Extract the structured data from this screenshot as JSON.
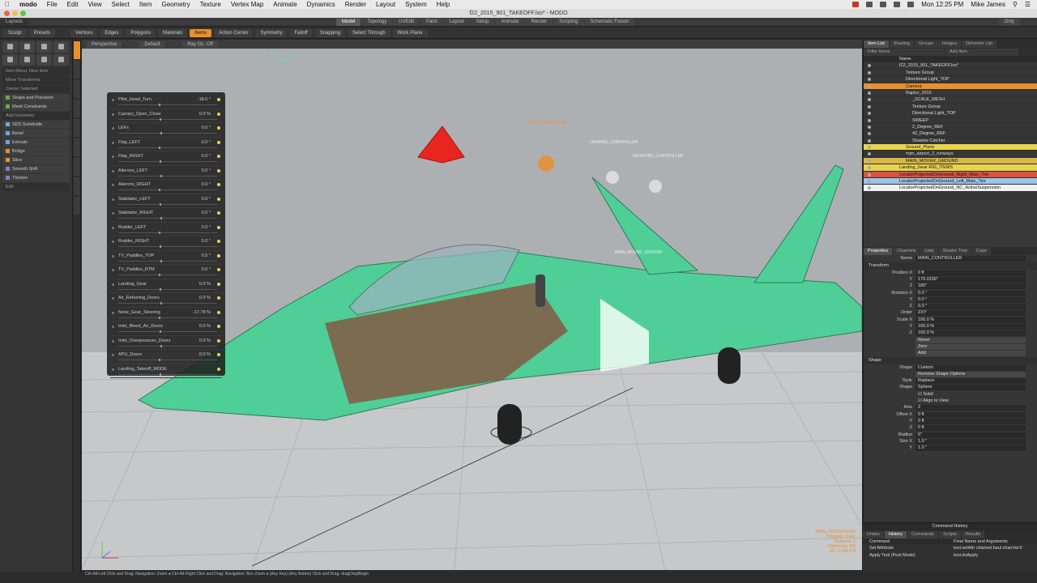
{
  "menubar": {
    "apple": "",
    "app_name": "modo",
    "items": [
      "File",
      "Edit",
      "View",
      "Select",
      "Item",
      "Geometry",
      "Texture",
      "Vertex Map",
      "Animate",
      "Dynamics",
      "Render",
      "Layout",
      "System",
      "Help"
    ],
    "clock": "Mon 12:25 PM",
    "user": "Mike James"
  },
  "window": {
    "title": "f22_2015_901_TAKEOFF.lxo* - MODO"
  },
  "layout_bar": {
    "layouts_label": "Layouts",
    "tabs": [
      "Model",
      "Topology",
      "UVEdit",
      "Paint",
      "Layout",
      "Setup",
      "Animate",
      "Render",
      "Scripting",
      "Schematic Fusion"
    ],
    "active_tab": "Model",
    "right_label": "Only"
  },
  "toolbar": {
    "items": [
      "Sculpt",
      "Presets",
      "Vertices",
      "Edges",
      "Polygons",
      "Materials",
      "Items",
      "Action Center",
      "Symmetry",
      "Falloff",
      "Snapping",
      "Select Through",
      "Work Plane"
    ],
    "active": "Items"
  },
  "left_panel": {
    "rows": [
      {
        "label": "Item Menu: New Item",
        "type": "hdr"
      },
      {
        "label": "Move Transforms",
        "type": "hdr"
      },
      {
        "label": "Center Selected",
        "type": "hdr"
      },
      {
        "label": "Shape and Precision",
        "type": "item"
      },
      {
        "label": "Mesh Constraints",
        "type": "item"
      },
      {
        "label": "Add Geometry",
        "type": "hdr"
      },
      {
        "label": "SDS Subdivide",
        "type": "item"
      },
      {
        "label": "Bevel",
        "type": "item"
      },
      {
        "label": "Extrude",
        "type": "item"
      },
      {
        "label": "Bridge",
        "type": "item"
      },
      {
        "label": "Slice",
        "type": "item"
      },
      {
        "label": "Smooth Shift",
        "type": "item"
      },
      {
        "label": "Thicken",
        "type": "item"
      },
      {
        "label": "Edit",
        "type": "hdr"
      }
    ]
  },
  "viewport": {
    "tabs": [
      "Perspective",
      "Default",
      "Ray GL: Off"
    ],
    "labels": [
      {
        "text": "MAIN_CONTROLLER",
        "color": "orange"
      },
      {
        "text": "LANDING_CONTROLLER",
        "color": "white"
      },
      {
        "text": "WEAPONS_CONTROLLER",
        "color": "white"
      },
      {
        "text": "MAIN_MOVER_GROUND",
        "color": "white"
      }
    ],
    "info_lines": [
      "MAIN_CONTROLLER",
      "Polygons : Face",
      "Channels: 1",
      "Deformers: ON",
      "GL: 1,288,478"
    ],
    "statusbar": "Ctrl-Alt-Left Click and Drag: Navigation: Zoom ● Ctrl-Alt-Right Click and Drag: Navigation: Box Zoom ● (Any Key)-(Any Button) Click and Drag: dragDropBegin"
  },
  "controller_panel": {
    "rows": [
      {
        "label": "Pilot_Head_Turn",
        "value": "-18.0 °"
      },
      {
        "label": "Canopy_Open_Close",
        "value": "0.0 %"
      },
      {
        "label": "LEFs",
        "value": "0.0 °"
      },
      {
        "label": "Flap_LEFT",
        "value": "0.0 °"
      },
      {
        "label": "Flap_RIGHT",
        "value": "0.0 °"
      },
      {
        "label": "Ailerons_LEFT",
        "value": "0.0 °"
      },
      {
        "label": "Ailerons_RIGHT",
        "value": "0.0 °"
      },
      {
        "label": "Stabilator_LEFT",
        "value": "0.0 °"
      },
      {
        "label": "Stabilator_RIGHT",
        "value": "0.0 °"
      },
      {
        "label": "Rudder_LEFT",
        "value": "0.0 °"
      },
      {
        "label": "Rudder_RIGHT",
        "value": "0.0 °"
      },
      {
        "label": "TV_Paddles_TOP",
        "value": "0.5 °"
      },
      {
        "label": "TV_Paddles_BTM",
        "value": "0.0 °"
      },
      {
        "label": "Landing_Gear",
        "value": "0.0 %"
      },
      {
        "label": "Air_Refueling_Doors",
        "value": "0.0 %"
      },
      {
        "label": "Nose_Gear_Steering",
        "value": "-17.78 %"
      },
      {
        "label": "Inlet_Bleed_Air_Doors",
        "value": "0.0 %"
      },
      {
        "label": "Inlet_Overpressure_Doors",
        "value": "0.0 %"
      },
      {
        "label": "APU_Doors",
        "value": "0.0 %"
      },
      {
        "label": "Landing_Takeoff_MODE",
        "value": ""
      }
    ]
  },
  "item_list": {
    "tabs": [
      "Item List",
      "Shading",
      "Groups",
      "Images",
      "Deformer List"
    ],
    "active_tab": "Item List",
    "filter_label": "Filter Items",
    "add_label": "Add Item",
    "column": "Name",
    "items": [
      {
        "name": "f22_2015_901_TAKEOFF.lxo*",
        "indent": 0,
        "hl": ""
      },
      {
        "name": "Texture Group",
        "indent": 1,
        "hl": ""
      },
      {
        "name": "Directional Light_TOP",
        "indent": 1,
        "hl": ""
      },
      {
        "name": "Camera",
        "indent": 1,
        "hl": "orange"
      },
      {
        "name": "Raptor_2015",
        "indent": 1,
        "hl": ""
      },
      {
        "name": "_SCALE_MESH",
        "indent": 2,
        "hl": ""
      },
      {
        "name": "Texture Group",
        "indent": 2,
        "hl": ""
      },
      {
        "name": "Directional Light_TOP",
        "indent": 2,
        "hl": ""
      },
      {
        "name": "SWEEP",
        "indent": 2,
        "hl": ""
      },
      {
        "name": "2_Degree_REF",
        "indent": 2,
        "hl": ""
      },
      {
        "name": "42_Degree_REF",
        "indent": 2,
        "hl": ""
      },
      {
        "name": "Shadow Catcher",
        "indent": 2,
        "hl": ""
      },
      {
        "name": "Ground_Plane",
        "indent": 1,
        "hl": "yellow"
      },
      {
        "name": "mjm_airport_2_runways",
        "indent": 1,
        "hl": ""
      },
      {
        "name": "MAIN_MOVER_GROUND",
        "indent": 1,
        "hl": "gold"
      },
      {
        "name": "Landing_Gear RIG_ITEMS",
        "indent": 0,
        "hl": "yellow"
      },
      {
        "name": "LocatorProjectedOnGround_Right_Main_Tire",
        "indent": 0,
        "hl": "red"
      },
      {
        "name": "LocatorProjectedOnGround_Left_Main_Tire",
        "indent": 0,
        "hl": "blue"
      },
      {
        "name": "LocatorProjectedOnGround_NC_ActiveSuspension",
        "indent": 0,
        "hl": "white"
      }
    ]
  },
  "properties": {
    "tabs": [
      "Properties",
      "Channels",
      "Lists",
      "Shader Tree",
      "Cops"
    ],
    "active_tab": "Properties",
    "name_label": "Name",
    "name_value": "MAIN_CONTROLLER",
    "transform_label": "Transform",
    "rows": [
      {
        "label": "Position X",
        "value": "0 ft"
      },
      {
        "label": "Y",
        "value": "170.0158\""
      },
      {
        "label": "Z",
        "value": "180\""
      },
      {
        "label": "Rotation X",
        "value": "0.0 °"
      },
      {
        "label": "Y",
        "value": "0.0 °"
      },
      {
        "label": "Z",
        "value": "0.0 °"
      },
      {
        "label": "Order",
        "value": "ZXY"
      },
      {
        "label": "Scale X",
        "value": "100.0 %"
      },
      {
        "label": "Y",
        "value": "100.0 %"
      },
      {
        "label": "Z",
        "value": "100.0 %"
      },
      {
        "label": "",
        "value": "Reset",
        "btn": true
      },
      {
        "label": "",
        "value": "Zero",
        "btn": true
      },
      {
        "label": "",
        "value": "Add",
        "btn": true
      }
    ],
    "shape_label": "Shape",
    "shape_rows": [
      {
        "label": "Shape",
        "value": "Custom"
      },
      {
        "label": "",
        "value": "Remove Shape Options",
        "btn": true
      },
      {
        "label": "Style",
        "value": "Replace"
      },
      {
        "label": "Shape",
        "value": "Sphere"
      },
      {
        "label": "",
        "value": "Solid",
        "check": true
      },
      {
        "label": "",
        "value": "Align to View",
        "check": true
      },
      {
        "label": "Axis",
        "value": "Z"
      },
      {
        "label": "Offset X",
        "value": "0 ft"
      },
      {
        "label": "Y",
        "value": "0 ft"
      },
      {
        "label": "Z",
        "value": "0 ft"
      },
      {
        "label": "Radius",
        "value": "6\""
      },
      {
        "label": "Size X",
        "value": "1.0 \""
      },
      {
        "label": "Y",
        "value": "1.0 \""
      }
    ]
  },
  "command_history": {
    "title": "Command History",
    "tabs": [
      "Undos",
      "History",
      "Commands",
      "Scripts",
      "Results"
    ],
    "active_tab": "History",
    "headers": [
      "Command",
      "Final Name and Arguments"
    ],
    "rows": [
      {
        "cmd": "Set Attribute",
        "args": "tool.setAttr channel.haul chanVal 0"
      },
      {
        "cmd": "Apply Tool (Post Mode)",
        "args": "tool.doApply"
      }
    ]
  }
}
